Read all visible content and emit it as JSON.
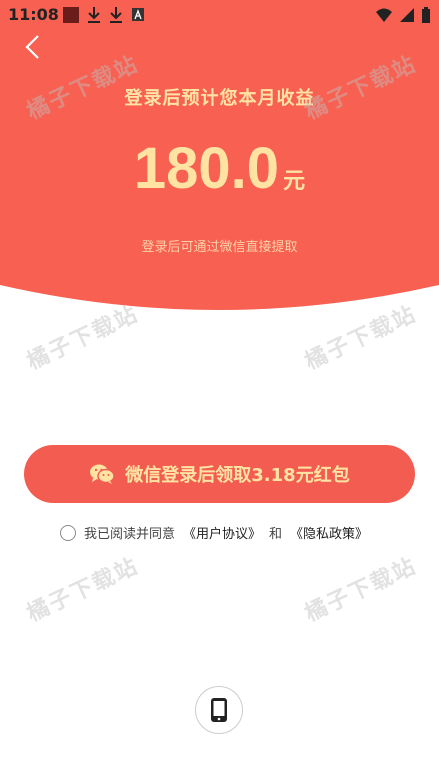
{
  "status_bar": {
    "time": "11:08"
  },
  "hero": {
    "title": "登录后预计您本月收益",
    "amount": "180.0",
    "unit": "元",
    "subtitle": "登录后可通过微信直接提取"
  },
  "watermark_text": "橘子下载站",
  "login_button": {
    "label": "微信登录后领取3.18元红包"
  },
  "agreement": {
    "prefix": "我已阅读并同意",
    "user_agreement": "《用户协议》",
    "and": "和",
    "privacy_policy": "《隐私政策》"
  },
  "colors": {
    "hero_bg": "#f86152",
    "accent_text": "#ffe3a3",
    "button_bg": "#f35d51"
  }
}
